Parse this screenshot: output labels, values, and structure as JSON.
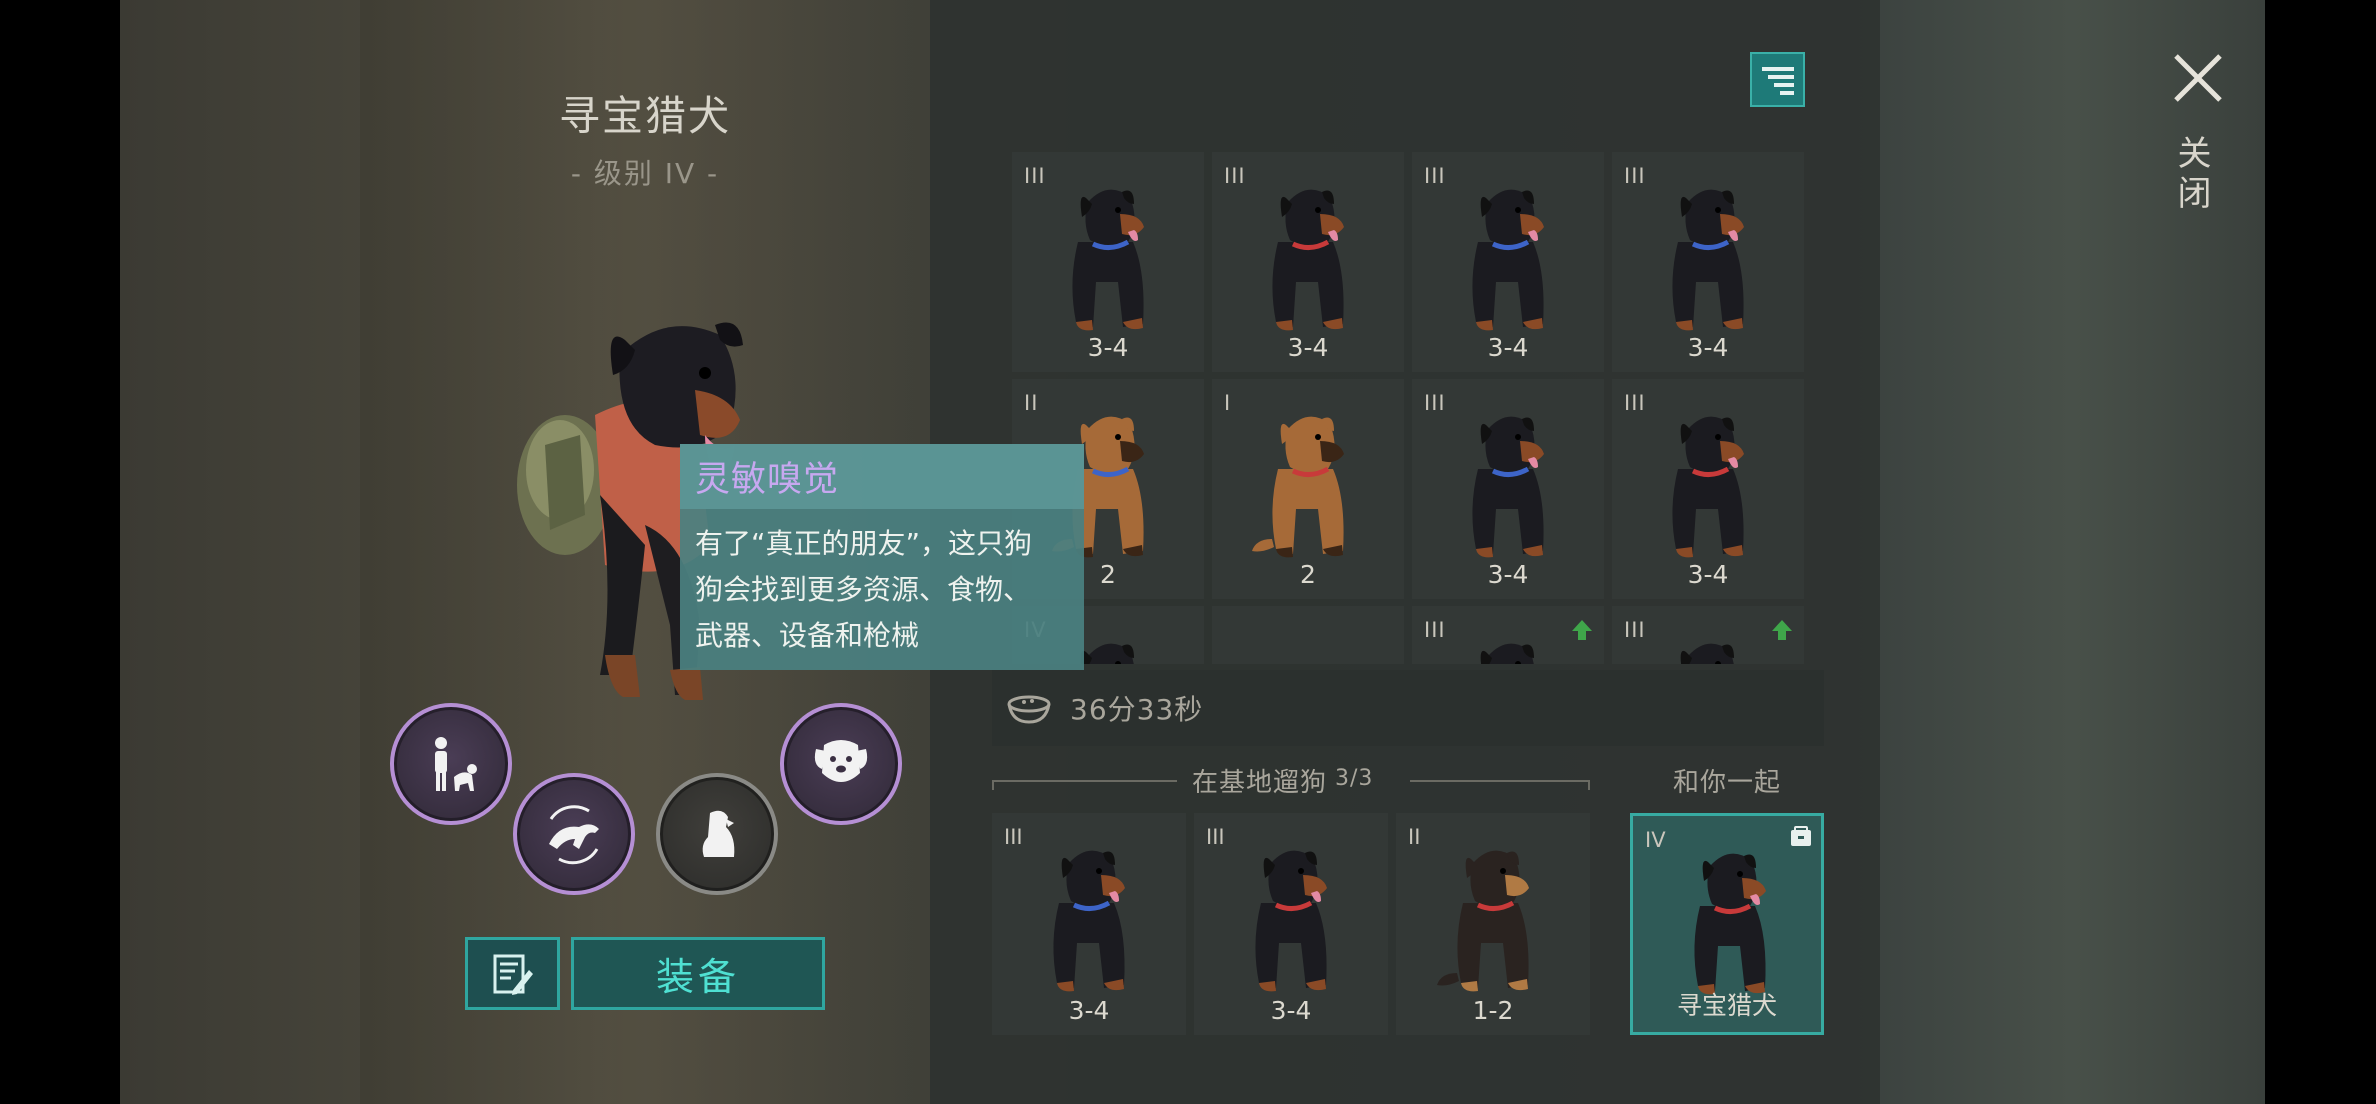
{
  "dog": {
    "name": "寻宝猎犬",
    "level": "- 级别 IV -"
  },
  "tooltip": {
    "title": "灵敏嗅觉",
    "lines": [
      "有了“真正的朋友”，这只狗",
      "狗会找到更多资源、食物、",
      "武器、设备和枪械"
    ]
  },
  "actions": {
    "equip_label": "装备"
  },
  "grid": {
    "rows": [
      [
        {
          "tier": "III",
          "label": "3-4",
          "breed": "rottweiler",
          "collar": "#3d64c8"
        },
        {
          "tier": "III",
          "label": "3-4",
          "breed": "rottweiler",
          "collar": "#c83a3a"
        },
        {
          "tier": "III",
          "label": "3-4",
          "breed": "rottweiler",
          "collar": "#3d64c8"
        },
        {
          "tier": "III",
          "label": "3-4",
          "breed": "rottweiler",
          "collar": "#3d64c8"
        }
      ],
      [
        {
          "tier": "II",
          "label": "2",
          "breed": "shepherd",
          "collar": "#3d64c8"
        },
        {
          "tier": "I",
          "label": "2",
          "breed": "shepherd",
          "collar": "#c83a3a"
        },
        {
          "tier": "III",
          "label": "3-4",
          "breed": "rottweiler",
          "collar": "#3d64c8"
        },
        {
          "tier": "III",
          "label": "3-4",
          "breed": "rottweiler",
          "collar": "#c83a3a"
        }
      ],
      [
        {
          "tier": "IV",
          "label": "",
          "breed": "rottweiler",
          "collar": "#3d64c8"
        },
        {
          "tier": "",
          "label": "",
          "breed": "",
          "collar": ""
        },
        {
          "tier": "III",
          "label": "",
          "breed": "rottweiler",
          "collar": "#3d64c8",
          "upgrade": true
        },
        {
          "tier": "III",
          "label": "",
          "breed": "rottweiler",
          "collar": "#c83a3a",
          "upgrade": true
        }
      ]
    ]
  },
  "timer": {
    "text": "36分33秒",
    "icon": "food-bowl-icon"
  },
  "walk": {
    "label": "在基地遛狗",
    "count": "3/3",
    "dogs": [
      {
        "tier": "III",
        "label": "3-4",
        "breed": "rottweiler",
        "collar": "#3d64c8"
      },
      {
        "tier": "III",
        "label": "3-4",
        "breed": "rottweiler",
        "collar": "#c83a3a"
      },
      {
        "tier": "II",
        "label": "1-2",
        "breed": "shepherd-dark",
        "collar": "#c83a3a"
      }
    ]
  },
  "companion": {
    "header": "和你一起",
    "tier": "IV",
    "label": "寻宝猎犬",
    "breed": "rottweiler",
    "collar": "#c83a3a"
  },
  "close": {
    "label": "关闭"
  },
  "colors": {
    "accent": "#2fa6a0",
    "equip_text": "#4fe0d2",
    "skill_ring": "#b58fd4",
    "tooltip_title": "#c7a8f0",
    "upgrade_arrow": "#3fa74a"
  }
}
